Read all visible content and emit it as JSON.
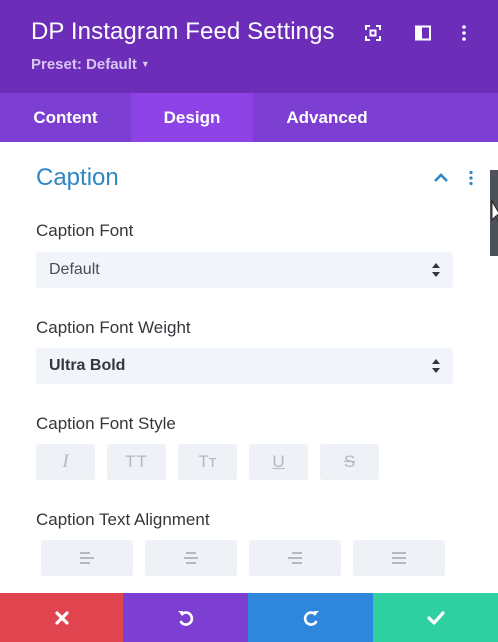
{
  "header": {
    "title": "DP Instagram Feed Settings",
    "preset_label": "Preset: Default",
    "icons": [
      "fullscreen-icon",
      "sidebar-layout-icon",
      "more-vertical-icon"
    ]
  },
  "tabs": [
    {
      "label": "Content",
      "active": false
    },
    {
      "label": "Design",
      "active": true
    },
    {
      "label": "Advanced",
      "active": false
    }
  ],
  "section": {
    "title": "Caption",
    "expanded": true
  },
  "fields": {
    "caption_font": {
      "label": "Caption Font",
      "value": "Default"
    },
    "caption_font_weight": {
      "label": "Caption Font Weight",
      "value": "Ultra Bold"
    },
    "caption_font_style": {
      "label": "Caption Font Style",
      "options": [
        {
          "name": "italic",
          "glyph": "I"
        },
        {
          "name": "uppercase",
          "glyph": "TT"
        },
        {
          "name": "capitalize",
          "glyph": "Tт"
        },
        {
          "name": "underline",
          "glyph": "U"
        },
        {
          "name": "strikethrough",
          "glyph": "S"
        }
      ]
    },
    "caption_text_alignment": {
      "label": "Caption Text Alignment",
      "options": [
        "left",
        "center",
        "right",
        "justify"
      ]
    }
  },
  "footer": {
    "buttons": [
      {
        "name": "discard",
        "color": "#e0444f"
      },
      {
        "name": "undo",
        "color": "#7c3fd1"
      },
      {
        "name": "redo",
        "color": "#2f86dd"
      },
      {
        "name": "save",
        "color": "#2ecfa0"
      }
    ]
  },
  "colors": {
    "header_bg": "#6c2eb9",
    "tabs_bg": "#7c3fd1",
    "active_tab_bg": "#8d43e6",
    "section_title": "#2f86c5"
  }
}
